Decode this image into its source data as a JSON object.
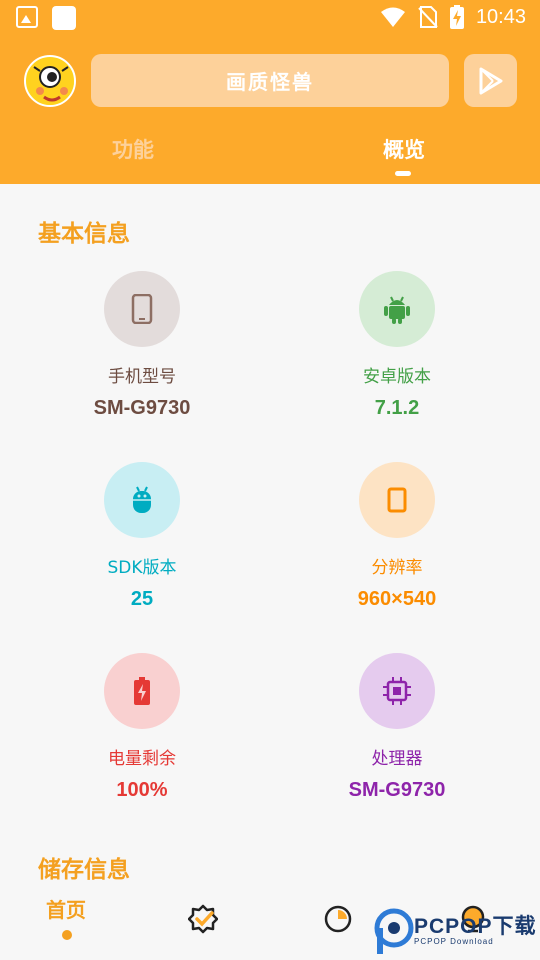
{
  "status_bar": {
    "time": "10:43"
  },
  "header": {
    "app_title": "画质怪兽",
    "tabs": [
      {
        "label": "功能",
        "active": false
      },
      {
        "label": "概览",
        "active": true
      }
    ]
  },
  "sections": {
    "basic_info_title": "基本信息",
    "storage_info_title": "储存信息"
  },
  "basic_info": {
    "phone_model": {
      "label": "手机型号",
      "value": "SM-G9730",
      "color": "#6d4c41",
      "bg": "#e3dcdb",
      "icon": "phone-icon"
    },
    "android_version": {
      "label": "安卓版本",
      "value": "7.1.2",
      "color": "#43a047",
      "bg": "#d5ecd5",
      "icon": "android-icon"
    },
    "sdk_version": {
      "label": "SDK版本",
      "value": "25",
      "color": "#00acc1",
      "bg": "#c8eef3",
      "icon": "android-head-icon"
    },
    "resolution": {
      "label": "分辨率",
      "value": "960×540",
      "color": "#fb8c00",
      "bg": "#fde3c4",
      "icon": "screen-icon"
    },
    "battery": {
      "label": "电量剩余",
      "value": "100%",
      "color": "#e53935",
      "bg": "#f9d0d0",
      "icon": "battery-charging-icon"
    },
    "processor": {
      "label": "处理器",
      "value": "SM-G9730",
      "color": "#8e24aa",
      "bg": "#e5cbee",
      "icon": "chip-icon"
    }
  },
  "bottom_nav": {
    "home_label": "首页",
    "icons": [
      "verified-badge-icon",
      "pie-chart-icon",
      "bulb-icon"
    ]
  },
  "watermark": {
    "brand": "PCPOP下载",
    "sub": "PCPOP Download"
  },
  "colors": {
    "accent": "#fdaa2b",
    "section_title": "#f4a020"
  }
}
